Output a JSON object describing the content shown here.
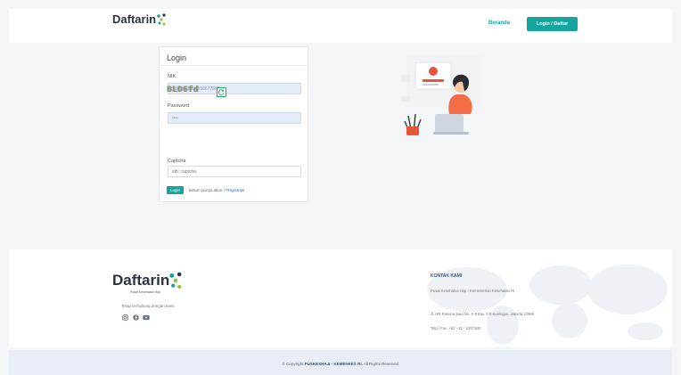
{
  "brand": {
    "name": "Daftarin",
    "subtitle": "Pusat Kesehatan Haji",
    "accent_color": "#15a59e",
    "logo_icon": "dna-helix-logo"
  },
  "nav": {
    "home_label": "Beranda",
    "login_button": "Login / Daftar"
  },
  "login_form": {
    "title": "Login",
    "nik_label": "NIK",
    "nik_value": "stb: 1122334556677889",
    "password_label": "Password",
    "password_value": "••••",
    "captcha_text": "BLD6fd",
    "refresh_icon": "refresh-icon",
    "captcha_label": "Captcha",
    "captcha_placeholder": "stb: captcha",
    "submit_label": "Login",
    "register_prompt": "Belum punya akun ?",
    "register_link": "Registrasi"
  },
  "footer": {
    "tagline": "Tetap terhubung dengan kami",
    "social_icons": [
      "instagram-icon",
      "facebook-icon",
      "youtube-icon"
    ],
    "contact_title": "KONTAK KAMI",
    "contact_org": "Pusat Kesehatan Haji - Kementerian Kesehatan RI",
    "contact_address": "Jl. HR Rasuna Said No. X-5 Kav. 4-9 Kuningan, Jakarta 12950",
    "contact_phone": "Telp / Fax. +62 - 21 - 5257480",
    "copyright_prefix": "© Copyright ",
    "copyright_org": "PUSKESHAJI - KEMENKES RI.",
    "copyright_suffix": " All Rights Reserved"
  }
}
